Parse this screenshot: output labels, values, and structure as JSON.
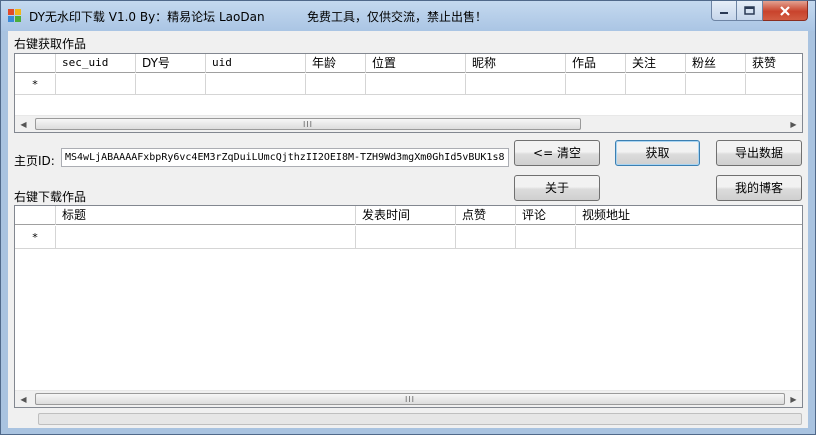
{
  "window": {
    "title": "DY无水印下载 V1.0 By：精易论坛 LaoDan",
    "notice": "免费工具，仅供交流，禁止出售！"
  },
  "top_section": {
    "label": "右键获取作品",
    "columns": [
      "sec_uid",
      "DY号",
      "uid",
      "年龄",
      "位置",
      "昵称",
      "作品",
      "关注",
      "粉丝",
      "获赞"
    ],
    "new_row_marker": "*"
  },
  "home_id": {
    "label": "主页ID:",
    "value": "MS4wLjABAAAAFxbpRy6vc4EM3rZqDuiLUmcQjthzII2OEI8M-TZH9Wd3mgXm0GhId5vBUK1s8"
  },
  "buttons": {
    "clear": "<= 清空",
    "fetch": "获取",
    "export": "导出数据",
    "about": "关于",
    "blog": "我的博客"
  },
  "bottom_section": {
    "label": "右键下载作品",
    "columns": [
      "标题",
      "发表时间",
      "点赞",
      "评论",
      "视频地址"
    ],
    "new_row_marker": "*"
  },
  "scrollbar": {
    "grip": "III",
    "left_arrow": "◀",
    "right_arrow": "▶"
  }
}
